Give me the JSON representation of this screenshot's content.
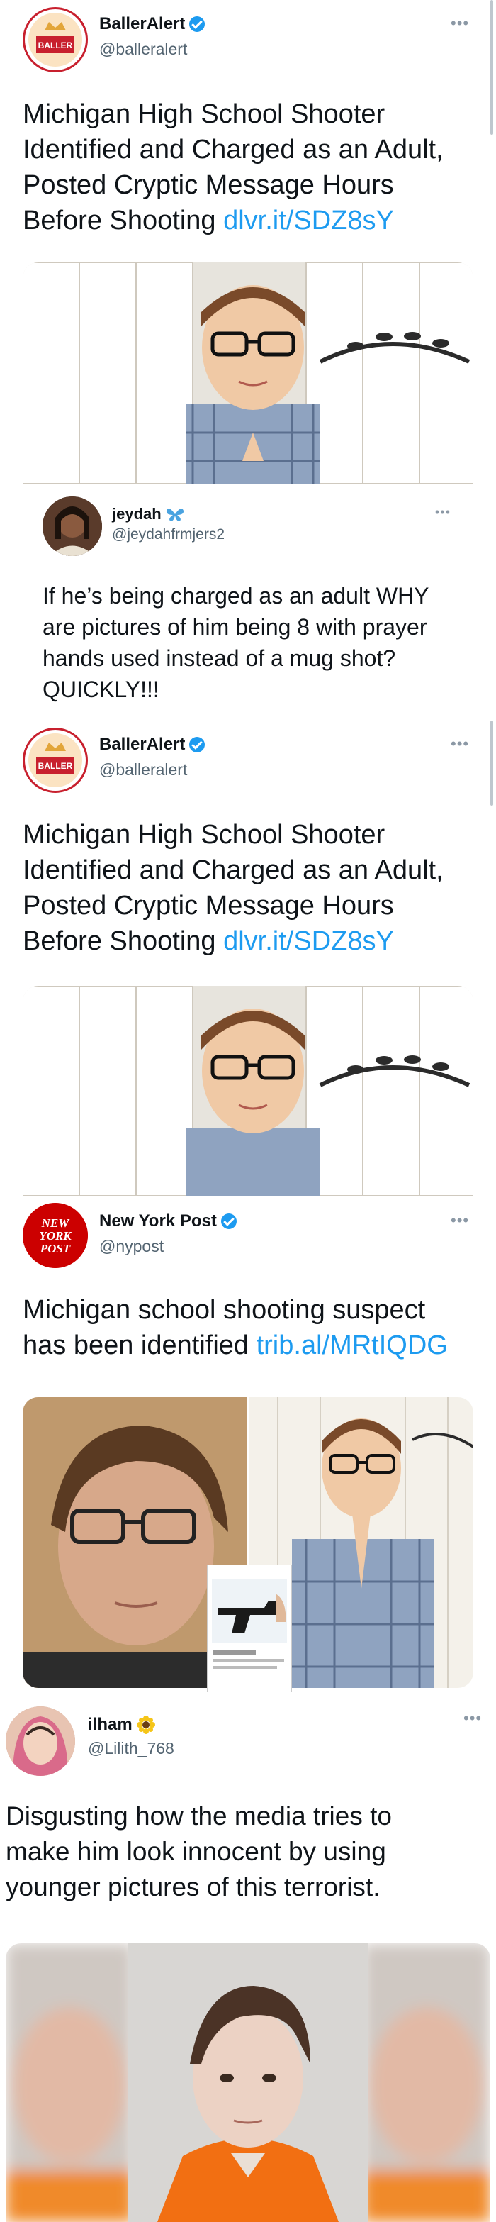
{
  "tweet1": {
    "name": "BallerAlert",
    "handle": "@balleralert",
    "text": "Michigan High School Shooter Identified and Charged as an Adult, Posted Cryptic Message Hours Before Shooting ",
    "link": "dlvr.it/SDZ8sY",
    "avatar_icon": "balleralert-logo-icon",
    "avatar_text": "BALLER ALERT"
  },
  "quote1": {
    "name": "jeydah",
    "name_icon": "butterfly-icon",
    "handle": "@jeydahfrmjers2",
    "text": "If he’s being charged as an adult WHY are pictures of him being 8 with prayer hands used instead of a mug shot? QUICKLY!!!"
  },
  "tweet2": {
    "name": "BallerAlert",
    "handle": "@balleralert",
    "text": "Michigan High School Shooter Identified and Charged as an Adult, Posted Cryptic Message Hours Before Shooting ",
    "link": "dlvr.it/SDZ8sY",
    "avatar_text": "BALLER ALERT"
  },
  "tweet3": {
    "name": "New York Post",
    "handle": "@nypost",
    "text": "Michigan school shooting suspect has been identified ",
    "link": "trib.al/MRtIQDG",
    "avatar_text": [
      "NEW",
      "YORK",
      "POST"
    ]
  },
  "tweet4": {
    "name": "ilham",
    "name_icon": "sunflower-icon",
    "handle": "@Lilith_768",
    "text": "Disgusting how the media tries to make him look innocent by using younger pictures of this terrorist."
  },
  "colors": {
    "link": "#1d9bf0",
    "verified": "#1d9bf0",
    "nypost_red": "#cc0000"
  }
}
